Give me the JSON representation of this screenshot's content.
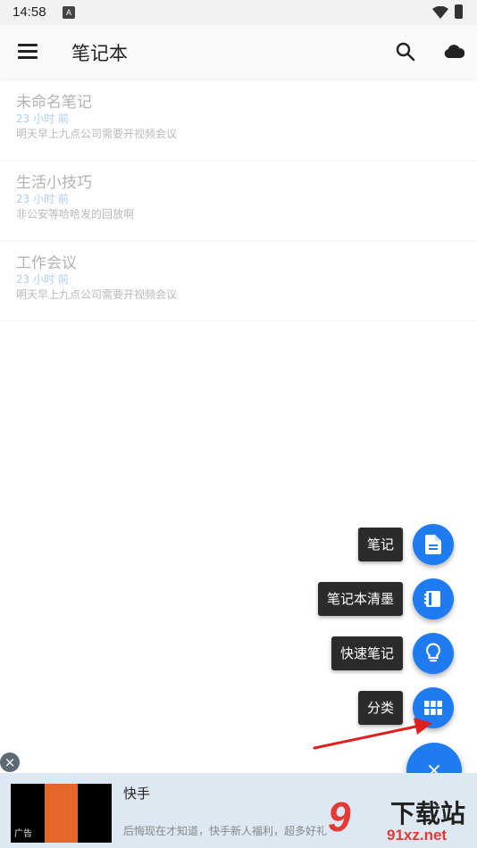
{
  "status": {
    "time": "14:58",
    "a_badge": "A"
  },
  "app_bar": {
    "title": "笔记本"
  },
  "notes": [
    {
      "title": "未命名笔记",
      "time": "23 小时 前",
      "body": "明天早上九点公司需要开视频会议"
    },
    {
      "title": "生活小技巧",
      "time": "23 小时 前",
      "body": "非公安等哈哈发的回放啊"
    },
    {
      "title": "工作会议",
      "time": "23 小时 前",
      "body": "明天早上九点公司需要开视频会议"
    }
  ],
  "fab_menu": {
    "items": [
      {
        "label": "笔记",
        "icon": "document-icon"
      },
      {
        "label": "笔记本清墨",
        "icon": "notebook-icon"
      },
      {
        "label": "快速笔记",
        "icon": "lightbulb-icon"
      },
      {
        "label": "分类",
        "icon": "grid-icon"
      }
    ],
    "main_icon": "close-icon",
    "main_symbol": "×"
  },
  "ad": {
    "close_symbol": "×",
    "title": "快手",
    "desc": "后悔现在才知道，快手新人福利，超多好礼",
    "badge": "广告"
  },
  "watermark": {
    "logo": "9",
    "cn": "下载站",
    "url": "91xz.net"
  },
  "colors": {
    "accent": "#1e7bf0",
    "time_text": "#4a90e2",
    "arrow": "#e02020"
  }
}
